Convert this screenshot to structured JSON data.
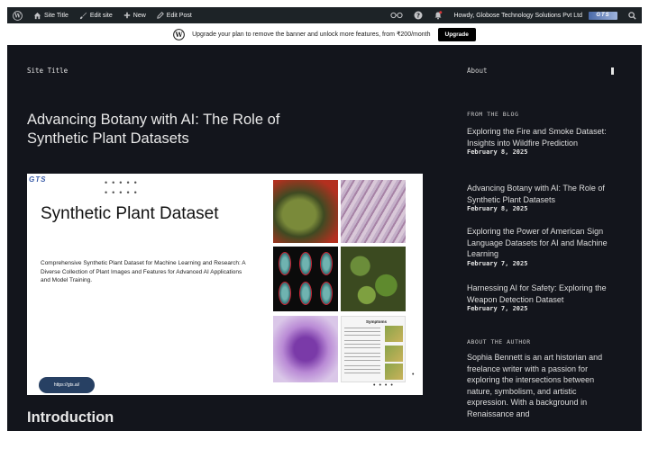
{
  "adminbar": {
    "site_title": "Site Title",
    "edit_site": "Edit site",
    "new": "New",
    "edit_post": "Edit Post",
    "howdy": "Howdy, Globose Technology Solutions Pvt Ltd",
    "avatar_text": "GTS"
  },
  "banner": {
    "text": "Upgrade your plan to remove the banner and unlock more features, from ₹200/month",
    "button": "Upgrade"
  },
  "header": {
    "site_title": "Site Title",
    "about": "About"
  },
  "post": {
    "title": "Advancing Botany with AI: The Role of Synthetic Plant Datasets",
    "section_heading": "Introduction"
  },
  "featured_image": {
    "logo": "GTS",
    "heading": "Synthetic Plant Dataset",
    "description": "Comprehensive Synthetic Plant Dataset for Machine Learning and Research: A Diverse Collection of Plant Images and Features for Advanced AI Applications and Model Training.",
    "url": "https://gts.ai/",
    "symptoms_label": "Symptoms"
  },
  "sidebar": {
    "blog_heading": "FROM THE BLOG",
    "posts": [
      {
        "title": "Exploring the Fire and Smoke Dataset: Insights into Wildfire Prediction",
        "date": "February 8, 2025"
      },
      {
        "title": "Advancing Botany with AI: The Role of Synthetic Plant Datasets",
        "date": "February 8, 2025"
      },
      {
        "title": "Exploring the Power of American Sign Language Datasets for AI and Machine Learning",
        "date": "February 7, 2025"
      },
      {
        "title": "Harnessing AI for Safety: Exploring the Weapon Detection Dataset",
        "date": "February 7, 2025"
      }
    ],
    "author_heading": "ABOUT THE AUTHOR",
    "author_bio": "Sophia Bennett is an art historian and freelance writer with a passion for exploring the intersections between nature, symbolism, and artistic expression. With a background in Renaissance and"
  },
  "colors": {
    "adminbar_bg": "#1d2327",
    "site_bg": "#13151c",
    "url_pill": "#274063"
  }
}
